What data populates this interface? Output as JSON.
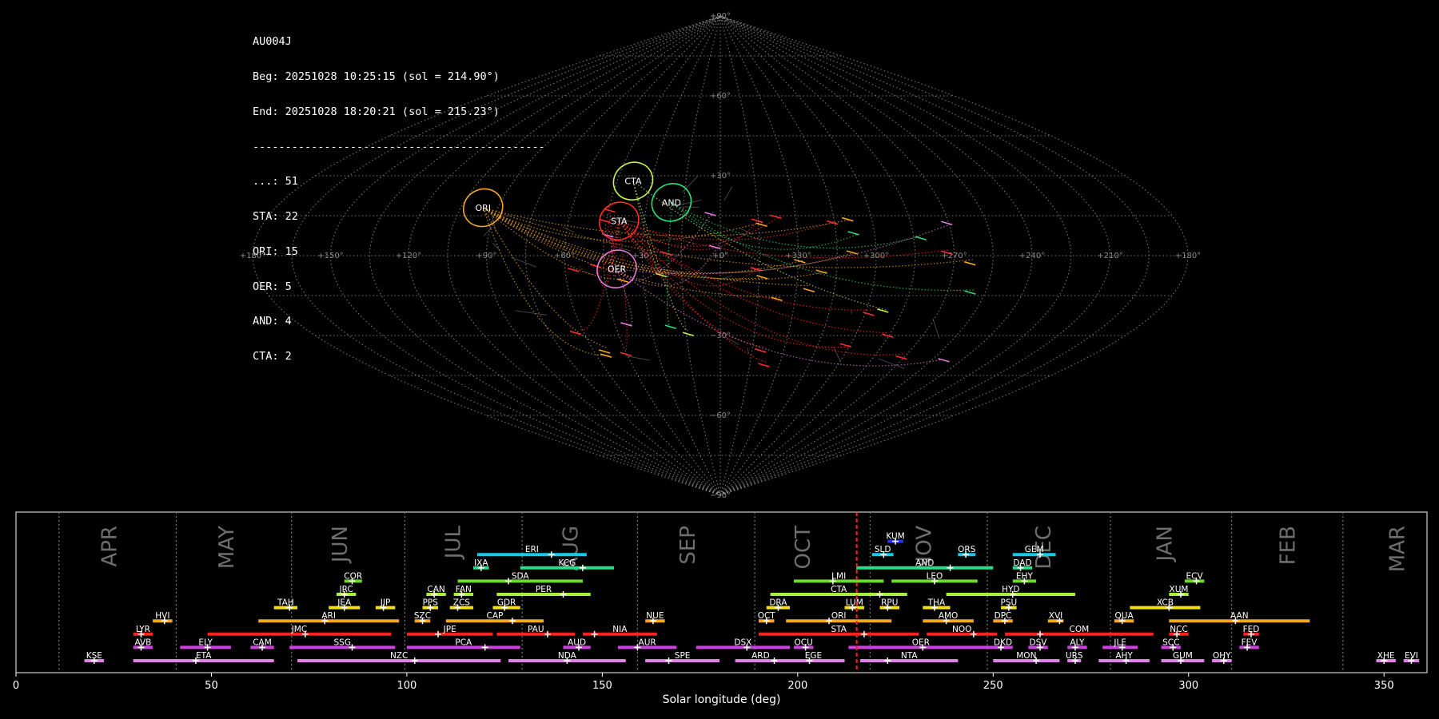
{
  "station": "AU004J",
  "begin_text": "Beg: 20251028 10:25:15 (sol = 214.90°)",
  "end_text": "End: 20251028 18:20:21 (sol = 215.23°)",
  "separator": "---------------------------------------------",
  "counts": [
    {
      "label": "...: 51"
    },
    {
      "label": "STA: 22"
    },
    {
      "label": "ORI: 15"
    },
    {
      "label": "OER: 5"
    },
    {
      "label": "AND: 4"
    },
    {
      "label": "CTA: 2"
    }
  ],
  "chart_data": [
    {
      "type": "sky-map",
      "projection": "sinusoidal",
      "ra_ticks": [
        "+180°",
        "+150°",
        "+120°",
        "+90°",
        "+60°",
        "+30°",
        "+0°",
        "+330°",
        "+300°",
        "+270°",
        "+240°",
        "+210°",
        "+180°"
      ],
      "dec_ticks": [
        "+90°",
        "+60°",
        "+30°",
        "+0°",
        "−30°",
        "−60°",
        "−90°"
      ],
      "showers": [
        {
          "code": "ORI",
          "color": "#f5a623",
          "ra": 96,
          "dec": 18
        },
        {
          "code": "CTA",
          "color": "#c6f04a",
          "ra": 38,
          "dec": 28
        },
        {
          "code": "STA",
          "color": "#ff2a2a",
          "ra": 40,
          "dec": 13
        },
        {
          "code": "AND",
          "color": "#27e07a",
          "ra": 20,
          "dec": 20
        },
        {
          "code": "OER",
          "color": "#e07ad8",
          "ra": 40,
          "dec": -5
        }
      ]
    },
    {
      "type": "timeline",
      "xlabel": "Solar longitude (deg)",
      "xlim": [
        0,
        361
      ],
      "x_ticks": [
        0,
        50,
        100,
        150,
        200,
        250,
        300,
        350
      ],
      "current_sol": 215.1,
      "month_boundaries": [
        11,
        41,
        70.5,
        99.5,
        129.5,
        159,
        189,
        218.5,
        248.5,
        280,
        311,
        339.5
      ],
      "months": [
        {
          "label": "APR",
          "at": 24
        },
        {
          "label": "MAY",
          "at": 54
        },
        {
          "label": "JUN",
          "at": 83
        },
        {
          "label": "JUL",
          "at": 112
        },
        {
          "label": "AUG",
          "at": 142
        },
        {
          "label": "SEP",
          "at": 172
        },
        {
          "label": "OCT",
          "at": 201.5
        },
        {
          "label": "NOV",
          "at": 232.5
        },
        {
          "label": "DEC",
          "at": 263
        },
        {
          "label": "JAN",
          "at": 294
        },
        {
          "label": "FEB",
          "at": 325.5
        },
        {
          "label": "MAR",
          "at": 353.5
        }
      ],
      "showers": [
        {
          "code": "KUM",
          "row": 10,
          "start": 223,
          "end": 227,
          "peak": 225,
          "color": "#2233ff"
        },
        {
          "code": "ERI",
          "row": 9,
          "start": 118,
          "end": 146,
          "peak": 137,
          "color": "#18c8f0"
        },
        {
          "code": "SLD",
          "row": 9,
          "start": 219,
          "end": 224.5,
          "peak": 222,
          "color": "#18c8f0"
        },
        {
          "code": "ORS",
          "row": 9,
          "start": 241,
          "end": 245.5,
          "peak": 243,
          "color": "#18c8f0"
        },
        {
          "code": "GEM",
          "row": 9,
          "start": 255,
          "end": 266,
          "peak": 262,
          "color": "#18c8f0"
        },
        {
          "code": "IXA",
          "row": 8,
          "start": 117,
          "end": 121,
          "peak": 119,
          "color": "#22e08a"
        },
        {
          "code": "KCG",
          "row": 8,
          "start": 129,
          "end": 153,
          "peak": 145,
          "color": "#22e08a"
        },
        {
          "code": "AND",
          "row": 8,
          "start": 215,
          "end": 250,
          "peak": 239,
          "color": "#22e08a"
        },
        {
          "code": "DAD",
          "row": 8,
          "start": 255,
          "end": 260,
          "peak": 257,
          "color": "#22e08a"
        },
        {
          "code": "COR",
          "row": 7,
          "start": 84,
          "end": 88.5,
          "peak": 86,
          "color": "#6ed830"
        },
        {
          "code": "SDA",
          "row": 7,
          "start": 113,
          "end": 145,
          "peak": 126,
          "color": "#6ed830"
        },
        {
          "code": "LMI",
          "row": 7,
          "start": 199,
          "end": 222,
          "peak": 209,
          "color": "#6ed830"
        },
        {
          "code": "LEO",
          "row": 7,
          "start": 224,
          "end": 246,
          "peak": 235,
          "color": "#6ed830"
        },
        {
          "code": "EHY",
          "row": 7,
          "start": 255,
          "end": 261,
          "peak": 258,
          "color": "#6ed830"
        },
        {
          "code": "ECV",
          "row": 7,
          "start": 299,
          "end": 304,
          "peak": 302,
          "color": "#6ed830"
        },
        {
          "code": "JRC",
          "row": 6,
          "start": 82,
          "end": 87,
          "peak": 84,
          "color": "#a8f038"
        },
        {
          "code": "CAN",
          "row": 6,
          "start": 105,
          "end": 110,
          "peak": 107,
          "color": "#a8f038"
        },
        {
          "code": "FAN",
          "row": 6,
          "start": 112,
          "end": 117,
          "peak": 114,
          "color": "#a8f038"
        },
        {
          "code": "PER",
          "row": 6,
          "start": 123,
          "end": 147,
          "peak": 140,
          "color": "#a8f038"
        },
        {
          "code": "CTA",
          "row": 6,
          "start": 193,
          "end": 228,
          "peak": 221,
          "color": "#a8f038"
        },
        {
          "code": "HYD",
          "row": 6,
          "start": 238,
          "end": 271,
          "peak": 255,
          "color": "#a8f038"
        },
        {
          "code": "XUM",
          "row": 6,
          "start": 295,
          "end": 300,
          "peak": 298,
          "color": "#a8f038"
        },
        {
          "code": "TAH",
          "row": 5,
          "start": 66,
          "end": 72,
          "peak": 70,
          "color": "#f5e400"
        },
        {
          "code": "JEA",
          "row": 5,
          "start": 80,
          "end": 88,
          "peak": 84,
          "color": "#f5e400"
        },
        {
          "code": "JIP",
          "row": 5,
          "start": 92,
          "end": 97,
          "peak": 94,
          "color": "#f5e400"
        },
        {
          "code": "PPS",
          "row": 5,
          "start": 104,
          "end": 108,
          "peak": 106,
          "color": "#f5e400"
        },
        {
          "code": "ZCS",
          "row": 5,
          "start": 111,
          "end": 117,
          "peak": 113,
          "color": "#f5e400"
        },
        {
          "code": "GDR",
          "row": 5,
          "start": 122,
          "end": 129,
          "peak": 125,
          "color": "#f5e400"
        },
        {
          "code": "DRA",
          "row": 5,
          "start": 192,
          "end": 198,
          "peak": 195,
          "color": "#f5e400"
        },
        {
          "code": "LUM",
          "row": 5,
          "start": 212,
          "end": 217,
          "peak": 214,
          "color": "#f5e400"
        },
        {
          "code": "RPU",
          "row": 5,
          "start": 221,
          "end": 226,
          "peak": 223,
          "color": "#f5e400"
        },
        {
          "code": "THA",
          "row": 5,
          "start": 232,
          "end": 239,
          "peak": 235,
          "color": "#f5e400"
        },
        {
          "code": "PSU",
          "row": 5,
          "start": 252,
          "end": 256,
          "peak": 254,
          "color": "#f5e400"
        },
        {
          "code": "XCB",
          "row": 5,
          "start": 285,
          "end": 303,
          "peak": 295,
          "color": "#f5e400"
        },
        {
          "code": "HVI",
          "row": 4,
          "start": 35,
          "end": 40,
          "peak": 38,
          "color": "#f5a623"
        },
        {
          "code": "ARI",
          "row": 4,
          "start": 62,
          "end": 98,
          "peak": 79,
          "color": "#f5a623"
        },
        {
          "code": "SZC",
          "row": 4,
          "start": 102,
          "end": 106,
          "peak": 104,
          "color": "#f5a623"
        },
        {
          "code": "CAP",
          "row": 4,
          "start": 110,
          "end": 135,
          "peak": 127,
          "color": "#f5a623"
        },
        {
          "code": "NUE",
          "row": 4,
          "start": 161,
          "end": 166,
          "peak": 163,
          "color": "#f5a623"
        },
        {
          "code": "OCT",
          "row": 4,
          "start": 190,
          "end": 194,
          "peak": 192,
          "color": "#f5a623"
        },
        {
          "code": "ORI",
          "row": 4,
          "start": 197,
          "end": 224,
          "peak": 208,
          "color": "#f5a623"
        },
        {
          "code": "AMO",
          "row": 4,
          "start": 232,
          "end": 245,
          "peak": 238,
          "color": "#f5a623"
        },
        {
          "code": "DPC",
          "row": 4,
          "start": 250,
          "end": 255,
          "peak": 253,
          "color": "#f5a623"
        },
        {
          "code": "XVI",
          "row": 4,
          "start": 264,
          "end": 268,
          "peak": 267,
          "color": "#f5a623"
        },
        {
          "code": "QUA",
          "row": 4,
          "start": 281,
          "end": 286,
          "peak": 283,
          "color": "#f5a623"
        },
        {
          "code": "AAN",
          "row": 4,
          "start": 295,
          "end": 331,
          "peak": 312,
          "color": "#f5a623"
        },
        {
          "code": "LYR",
          "row": 3,
          "start": 30,
          "end": 35,
          "peak": 32,
          "color": "#ff2020"
        },
        {
          "code": "JMC",
          "row": 3,
          "start": 49,
          "end": 96,
          "peak": 74,
          "color": "#ff2020"
        },
        {
          "code": "JPE",
          "row": 3,
          "start": 100,
          "end": 122,
          "peak": 108,
          "color": "#ff2020"
        },
        {
          "code": "PAU",
          "row": 3,
          "start": 123,
          "end": 143,
          "peak": 136,
          "color": "#ff2020"
        },
        {
          "code": "NIA",
          "row": 3,
          "start": 145,
          "end": 164,
          "peak": 148,
          "color": "#ff2020"
        },
        {
          "code": "STA",
          "row": 3,
          "start": 190,
          "end": 231,
          "peak": 217,
          "color": "#ff2020"
        },
        {
          "code": "NOO",
          "row": 3,
          "start": 233,
          "end": 251,
          "peak": 245,
          "color": "#ff2020"
        },
        {
          "code": "COM",
          "row": 3,
          "start": 253,
          "end": 291,
          "peak": 262,
          "color": "#ff2020"
        },
        {
          "code": "NCC",
          "row": 3,
          "start": 295,
          "end": 300,
          "peak": 297,
          "color": "#ff2020"
        },
        {
          "code": "FED",
          "row": 3,
          "start": 314,
          "end": 318,
          "peak": 316,
          "color": "#ff2020"
        },
        {
          "code": "AVB",
          "row": 2,
          "start": 30,
          "end": 35,
          "peak": 32,
          "color": "#d040e0"
        },
        {
          "code": "ELY",
          "row": 2,
          "start": 42,
          "end": 55,
          "peak": 49,
          "color": "#d040e0"
        },
        {
          "code": "CAM",
          "row": 2,
          "start": 60,
          "end": 66,
          "peak": 63,
          "color": "#d040e0"
        },
        {
          "code": "SSG",
          "row": 2,
          "start": 70,
          "end": 97,
          "peak": 86,
          "color": "#d040e0"
        },
        {
          "code": "PCA",
          "row": 2,
          "start": 100,
          "end": 129,
          "peak": 120,
          "color": "#d040e0"
        },
        {
          "code": "AUD",
          "row": 2,
          "start": 140,
          "end": 147,
          "peak": 144,
          "color": "#d040e0"
        },
        {
          "code": "AUR",
          "row": 2,
          "start": 154,
          "end": 169,
          "peak": 159,
          "color": "#d040e0"
        },
        {
          "code": "DSX",
          "row": 2,
          "start": 174,
          "end": 198,
          "peak": 187,
          "color": "#d040e0"
        },
        {
          "code": "OCU",
          "row": 2,
          "start": 199,
          "end": 204,
          "peak": 202,
          "color": "#d040e0"
        },
        {
          "code": "OER",
          "row": 2,
          "start": 213,
          "end": 250,
          "peak": 232,
          "color": "#d040e0"
        },
        {
          "code": "DKD",
          "row": 2,
          "start": 250,
          "end": 255,
          "peak": 252,
          "color": "#d040e0"
        },
        {
          "code": "DSV",
          "row": 2,
          "start": 259,
          "end": 264,
          "peak": 262,
          "color": "#d040e0"
        },
        {
          "code": "ALY",
          "row": 2,
          "start": 269,
          "end": 274,
          "peak": 271,
          "color": "#d040e0"
        },
        {
          "code": "JLE",
          "row": 2,
          "start": 278,
          "end": 287,
          "peak": 283,
          "color": "#d040e0"
        },
        {
          "code": "SCC",
          "row": 2,
          "start": 293,
          "end": 298,
          "peak": 296,
          "color": "#d040e0"
        },
        {
          "code": "FEV",
          "row": 2,
          "start": 313,
          "end": 318,
          "peak": 315,
          "color": "#d040e0"
        },
        {
          "code": "KSE",
          "row": 1,
          "start": 17.5,
          "end": 22.5,
          "peak": 20,
          "color": "#e080e8"
        },
        {
          "code": "ETA",
          "row": 1,
          "start": 30,
          "end": 66,
          "peak": 46,
          "color": "#e080e8"
        },
        {
          "code": "NZC",
          "row": 1,
          "start": 72,
          "end": 124,
          "peak": 102,
          "color": "#e080e8"
        },
        {
          "code": "NDA",
          "row": 1,
          "start": 126,
          "end": 156,
          "peak": 141,
          "color": "#e080e8"
        },
        {
          "code": "SPE",
          "row": 1,
          "start": 161,
          "end": 180,
          "peak": 167,
          "color": "#e080e8"
        },
        {
          "code": "ARD",
          "row": 1,
          "start": 184,
          "end": 197,
          "peak": 194,
          "color": "#e080e8"
        },
        {
          "code": "EGE",
          "row": 1,
          "start": 196,
          "end": 212,
          "peak": 203,
          "color": "#e080e8"
        },
        {
          "code": "NTA",
          "row": 1,
          "start": 216,
          "end": 241,
          "peak": 223,
          "color": "#e080e8"
        },
        {
          "code": "MON",
          "row": 1,
          "start": 250,
          "end": 267,
          "peak": 261,
          "color": "#e080e8"
        },
        {
          "code": "URS",
          "row": 1,
          "start": 269,
          "end": 272.5,
          "peak": 271,
          "color": "#e080e8"
        },
        {
          "code": "AHY",
          "row": 1,
          "start": 277,
          "end": 290,
          "peak": 284,
          "color": "#e080e8"
        },
        {
          "code": "GUM",
          "row": 1,
          "start": 293,
          "end": 304,
          "peak": 298,
          "color": "#e080e8"
        },
        {
          "code": "OHY",
          "row": 1,
          "start": 306,
          "end": 311,
          "peak": 309,
          "color": "#e080e8"
        },
        {
          "code": "XHE",
          "row": 1,
          "start": 348,
          "end": 353,
          "peak": 350,
          "color": "#e080e8"
        },
        {
          "code": "EVI",
          "row": 1,
          "start": 355,
          "end": 359,
          "peak": 357,
          "color": "#e080e8"
        }
      ]
    }
  ]
}
